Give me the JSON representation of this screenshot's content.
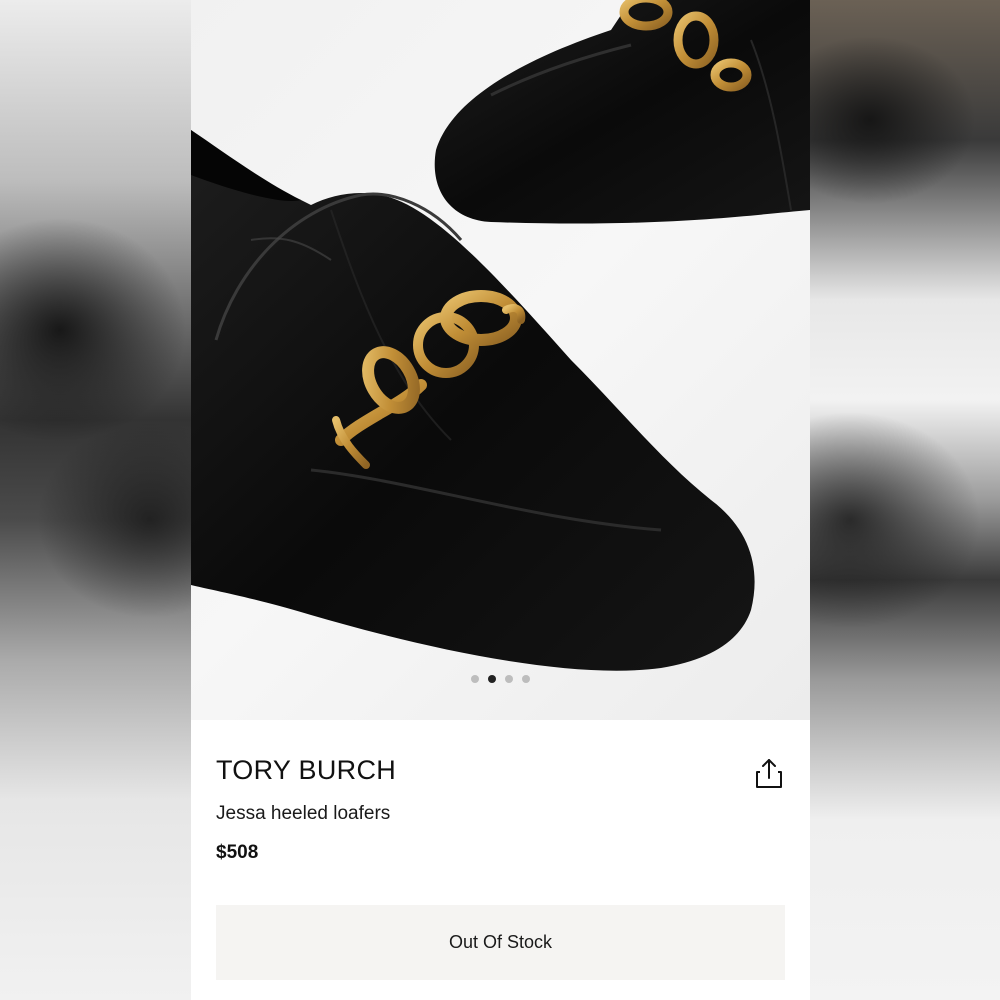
{
  "product": {
    "brand": "TORY BURCH",
    "name": "Jessa heeled loafers",
    "price": "$508",
    "image_description": "",
    "image_count": 4,
    "image_active_index": 1
  },
  "actions": {
    "share_icon": "share-icon",
    "stock_label": "Out Of Stock"
  },
  "colors": {
    "leather": "#0d0d0d",
    "hardware_gold": "#c99a3f",
    "button_bg": "#f5f4f2",
    "dot_active": "#222222",
    "dot_inactive": "#bdbdbd"
  }
}
